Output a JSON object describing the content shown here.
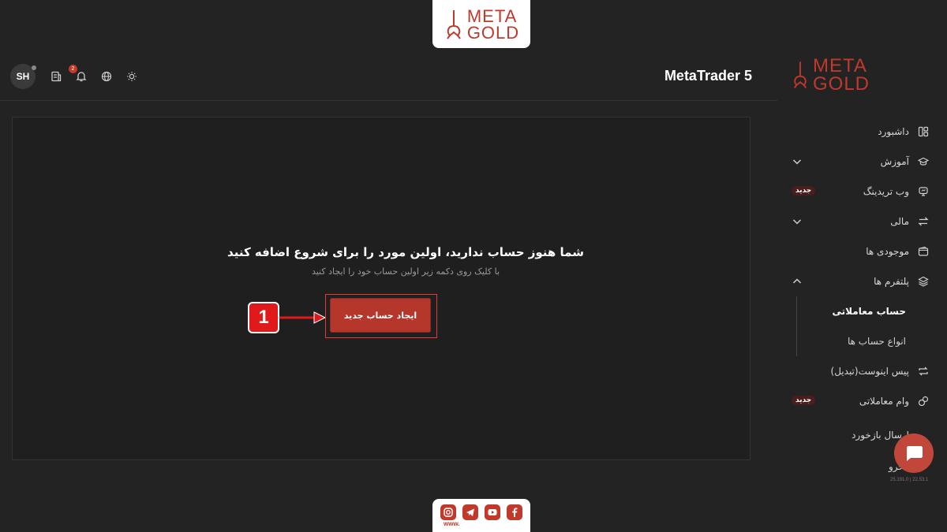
{
  "brand": {
    "logo_line1": "META",
    "logo_line2": "GOLD"
  },
  "header": {
    "avatar_initials": "SH",
    "notification_count": "2",
    "app_title": "MetaTrader 5"
  },
  "sidebar": {
    "items": [
      {
        "label": "داشبورد",
        "icon": "dashboard-icon"
      },
      {
        "label": "آموزش",
        "icon": "graduation-cap-icon"
      },
      {
        "label": "وب تریدینگ",
        "icon": "monitor-icon",
        "badge": "جدید"
      },
      {
        "label": "مالی",
        "icon": "transfer-arrows-icon"
      },
      {
        "label": "موجودی ها",
        "icon": "wallet-icon"
      },
      {
        "label": "پلتفرم ها",
        "icon": "layers-icon"
      }
    ],
    "sub_items": [
      {
        "label": "حساب معاملاتی",
        "active": true
      },
      {
        "label": "انواع حساب ها",
        "active": false
      }
    ],
    "items_after": [
      {
        "label": "پیس اینوست(تبدیل)",
        "icon": "repeat-icon"
      },
      {
        "label": "وام معاملاتی",
        "icon": "coins-icon",
        "badge": "جدید"
      }
    ],
    "feedback_label": "ارسال بازخورد",
    "logout_label": "خرو",
    "version": "25.191.0 | 22.53.1"
  },
  "main": {
    "empty_title": "شما هنوز حساب ندارید، اولین مورد را برای شروع اضافه کنید",
    "empty_subtitle": "با کلیک روی دکمه زیر اولین حساب خود را ایجاد کنید",
    "create_button": "ایجاد حساب جدید",
    "step_number": "1"
  },
  "footer": {
    "www": "www."
  },
  "colors": {
    "accent": "#c0392b",
    "background": "#232323",
    "marker": "#e01a1a"
  }
}
